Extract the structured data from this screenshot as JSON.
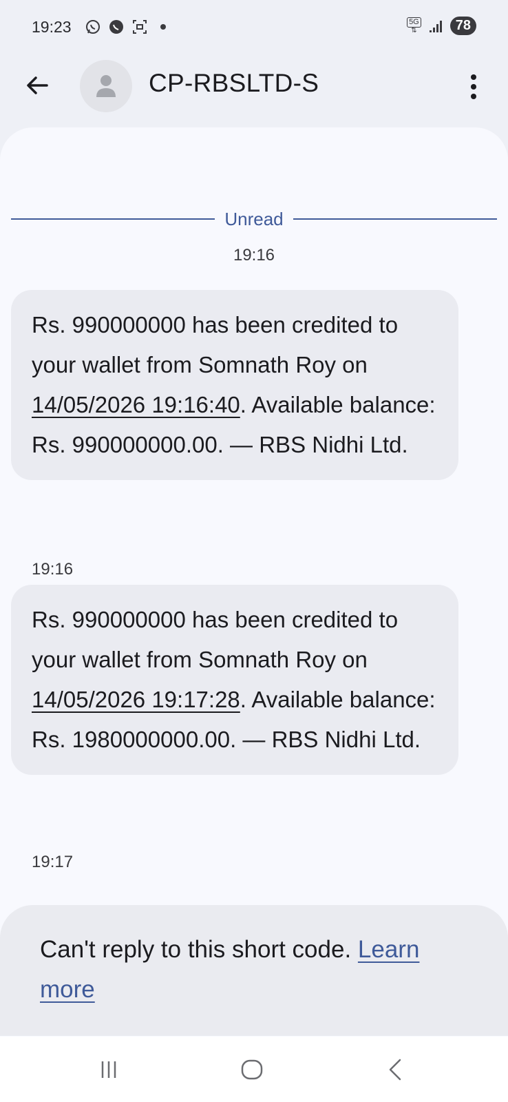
{
  "status_bar": {
    "time": "19:23",
    "battery": "78",
    "network_label": "5G",
    "icons": [
      "whatsapp-icon",
      "whatsapp-business-icon",
      "screenshot-icon",
      "dot-icon",
      "5g-icon",
      "signal-icon",
      "battery-icon"
    ]
  },
  "header": {
    "contact_name": "CP-RBSLTD-S",
    "icons": [
      "back-arrow-icon",
      "person-icon",
      "more-vert-icon"
    ]
  },
  "conversation": {
    "unread_label": "Unread",
    "first_timestamp": "19:16",
    "messages": [
      {
        "text_part1": "Rs. 990000000 has been credited to your wallet from Somnath Roy on ",
        "link": "14/05/2026 19:16:40",
        "text_part2": ". Available balance: Rs. 990000000.00. — RBS Nidhi Ltd.",
        "time": "19:16"
      },
      {
        "text_part1": "Rs. 990000000 has been credited to your wallet from Somnath Roy on ",
        "link": "14/05/2026 19:17:28",
        "text_part2": ". Available balance: Rs. 1980000000.00. — RBS Nidhi Ltd.",
        "time": "19:17"
      }
    ]
  },
  "footer": {
    "notice": "Can't reply to this short code. ",
    "learn_more": "Learn more"
  },
  "nav_bar": {
    "icons": [
      "recent-apps-icon",
      "home-icon",
      "back-icon"
    ]
  },
  "colors": {
    "accent": "#3f5a99",
    "bubble": "#eaebf1",
    "background": "#eef0f6"
  }
}
